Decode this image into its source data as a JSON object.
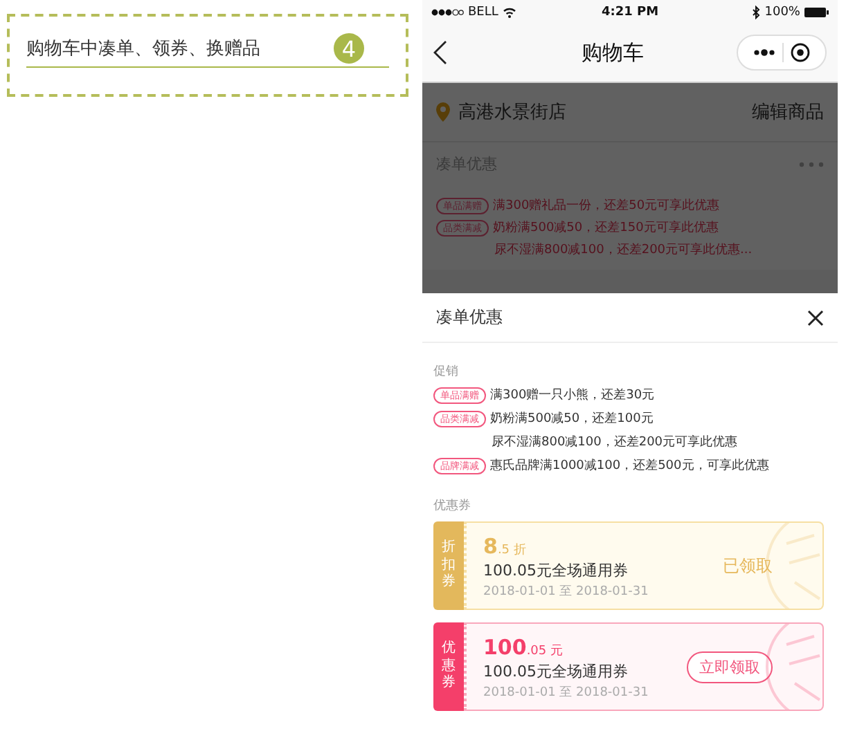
{
  "annotation": {
    "text": "购物车中凑单、领券、换赠品",
    "step": "4"
  },
  "status_bar": {
    "carrier": "BELL",
    "time": "4:21 PM",
    "battery": "100%"
  },
  "nav": {
    "title": "购物车"
  },
  "cart": {
    "store": "高港水景街店",
    "edit": "编辑商品",
    "section_title": "凑单优惠",
    "promos": [
      {
        "tag": "单品满赠",
        "text": "满300赠礼品一份，还差50元可享此优惠"
      },
      {
        "tag": "品类满减",
        "text": "奶粉满500减50，还差150元可享此优惠"
      },
      {
        "text": "尿不湿满800减100，还差200元可享此优惠..."
      }
    ]
  },
  "sheet": {
    "title": "凑单优惠",
    "promo_label": "促销",
    "promos": [
      {
        "tag": "单品满赠",
        "text": "满300赠一只小熊，还差30元"
      },
      {
        "tag": "品类满减",
        "text": "奶粉满500减50，还差100元"
      },
      {
        "text": "尿不湿满800减100，还差200元可享此优惠"
      },
      {
        "tag": "品牌满减",
        "text": "惠氏品牌满1000减100，还差500元，可享此优惠"
      }
    ],
    "coupon_label": "优惠券",
    "coupons": [
      {
        "kind": "discount",
        "side_label": "折扣券",
        "amount_main": "8",
        "amount_decimal": ".5",
        "unit": "折",
        "name": "100.05元全场通用券",
        "dates": "2018-01-01 至 2018-01-31",
        "action": "已领取",
        "claimed": true
      },
      {
        "kind": "cash",
        "side_label": "优惠券",
        "amount_main": "100",
        "amount_decimal": ".05",
        "unit": "元",
        "name": "100.05元全场通用券",
        "dates": "2018-01-01 至 2018-01-31",
        "action": "立即领取",
        "claimed": false
      }
    ]
  }
}
